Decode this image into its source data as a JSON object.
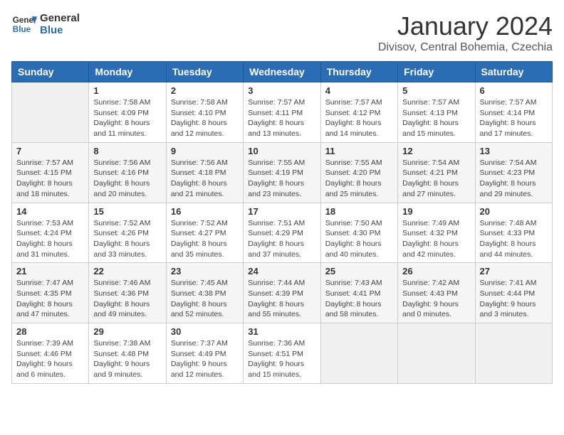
{
  "header": {
    "logo_line1": "General",
    "logo_line2": "Blue",
    "title": "January 2024",
    "subtitle": "Divisov, Central Bohemia, Czechia"
  },
  "weekdays": [
    "Sunday",
    "Monday",
    "Tuesday",
    "Wednesday",
    "Thursday",
    "Friday",
    "Saturday"
  ],
  "weeks": [
    [
      {
        "day": "",
        "info": ""
      },
      {
        "day": "1",
        "info": "Sunrise: 7:58 AM\nSunset: 4:09 PM\nDaylight: 8 hours\nand 11 minutes."
      },
      {
        "day": "2",
        "info": "Sunrise: 7:58 AM\nSunset: 4:10 PM\nDaylight: 8 hours\nand 12 minutes."
      },
      {
        "day": "3",
        "info": "Sunrise: 7:57 AM\nSunset: 4:11 PM\nDaylight: 8 hours\nand 13 minutes."
      },
      {
        "day": "4",
        "info": "Sunrise: 7:57 AM\nSunset: 4:12 PM\nDaylight: 8 hours\nand 14 minutes."
      },
      {
        "day": "5",
        "info": "Sunrise: 7:57 AM\nSunset: 4:13 PM\nDaylight: 8 hours\nand 15 minutes."
      },
      {
        "day": "6",
        "info": "Sunrise: 7:57 AM\nSunset: 4:14 PM\nDaylight: 8 hours\nand 17 minutes."
      }
    ],
    [
      {
        "day": "7",
        "info": "Sunrise: 7:57 AM\nSunset: 4:15 PM\nDaylight: 8 hours\nand 18 minutes."
      },
      {
        "day": "8",
        "info": "Sunrise: 7:56 AM\nSunset: 4:16 PM\nDaylight: 8 hours\nand 20 minutes."
      },
      {
        "day": "9",
        "info": "Sunrise: 7:56 AM\nSunset: 4:18 PM\nDaylight: 8 hours\nand 21 minutes."
      },
      {
        "day": "10",
        "info": "Sunrise: 7:55 AM\nSunset: 4:19 PM\nDaylight: 8 hours\nand 23 minutes."
      },
      {
        "day": "11",
        "info": "Sunrise: 7:55 AM\nSunset: 4:20 PM\nDaylight: 8 hours\nand 25 minutes."
      },
      {
        "day": "12",
        "info": "Sunrise: 7:54 AM\nSunset: 4:21 PM\nDaylight: 8 hours\nand 27 minutes."
      },
      {
        "day": "13",
        "info": "Sunrise: 7:54 AM\nSunset: 4:23 PM\nDaylight: 8 hours\nand 29 minutes."
      }
    ],
    [
      {
        "day": "14",
        "info": "Sunrise: 7:53 AM\nSunset: 4:24 PM\nDaylight: 8 hours\nand 31 minutes."
      },
      {
        "day": "15",
        "info": "Sunrise: 7:52 AM\nSunset: 4:26 PM\nDaylight: 8 hours\nand 33 minutes."
      },
      {
        "day": "16",
        "info": "Sunrise: 7:52 AM\nSunset: 4:27 PM\nDaylight: 8 hours\nand 35 minutes."
      },
      {
        "day": "17",
        "info": "Sunrise: 7:51 AM\nSunset: 4:29 PM\nDaylight: 8 hours\nand 37 minutes."
      },
      {
        "day": "18",
        "info": "Sunrise: 7:50 AM\nSunset: 4:30 PM\nDaylight: 8 hours\nand 40 minutes."
      },
      {
        "day": "19",
        "info": "Sunrise: 7:49 AM\nSunset: 4:32 PM\nDaylight: 8 hours\nand 42 minutes."
      },
      {
        "day": "20",
        "info": "Sunrise: 7:48 AM\nSunset: 4:33 PM\nDaylight: 8 hours\nand 44 minutes."
      }
    ],
    [
      {
        "day": "21",
        "info": "Sunrise: 7:47 AM\nSunset: 4:35 PM\nDaylight: 8 hours\nand 47 minutes."
      },
      {
        "day": "22",
        "info": "Sunrise: 7:46 AM\nSunset: 4:36 PM\nDaylight: 8 hours\nand 49 minutes."
      },
      {
        "day": "23",
        "info": "Sunrise: 7:45 AM\nSunset: 4:38 PM\nDaylight: 8 hours\nand 52 minutes."
      },
      {
        "day": "24",
        "info": "Sunrise: 7:44 AM\nSunset: 4:39 PM\nDaylight: 8 hours\nand 55 minutes."
      },
      {
        "day": "25",
        "info": "Sunrise: 7:43 AM\nSunset: 4:41 PM\nDaylight: 8 hours\nand 58 minutes."
      },
      {
        "day": "26",
        "info": "Sunrise: 7:42 AM\nSunset: 4:43 PM\nDaylight: 9 hours\nand 0 minutes."
      },
      {
        "day": "27",
        "info": "Sunrise: 7:41 AM\nSunset: 4:44 PM\nDaylight: 9 hours\nand 3 minutes."
      }
    ],
    [
      {
        "day": "28",
        "info": "Sunrise: 7:39 AM\nSunset: 4:46 PM\nDaylight: 9 hours\nand 6 minutes."
      },
      {
        "day": "29",
        "info": "Sunrise: 7:38 AM\nSunset: 4:48 PM\nDaylight: 9 hours\nand 9 minutes."
      },
      {
        "day": "30",
        "info": "Sunrise: 7:37 AM\nSunset: 4:49 PM\nDaylight: 9 hours\nand 12 minutes."
      },
      {
        "day": "31",
        "info": "Sunrise: 7:36 AM\nSunset: 4:51 PM\nDaylight: 9 hours\nand 15 minutes."
      },
      {
        "day": "",
        "info": ""
      },
      {
        "day": "",
        "info": ""
      },
      {
        "day": "",
        "info": ""
      }
    ]
  ]
}
